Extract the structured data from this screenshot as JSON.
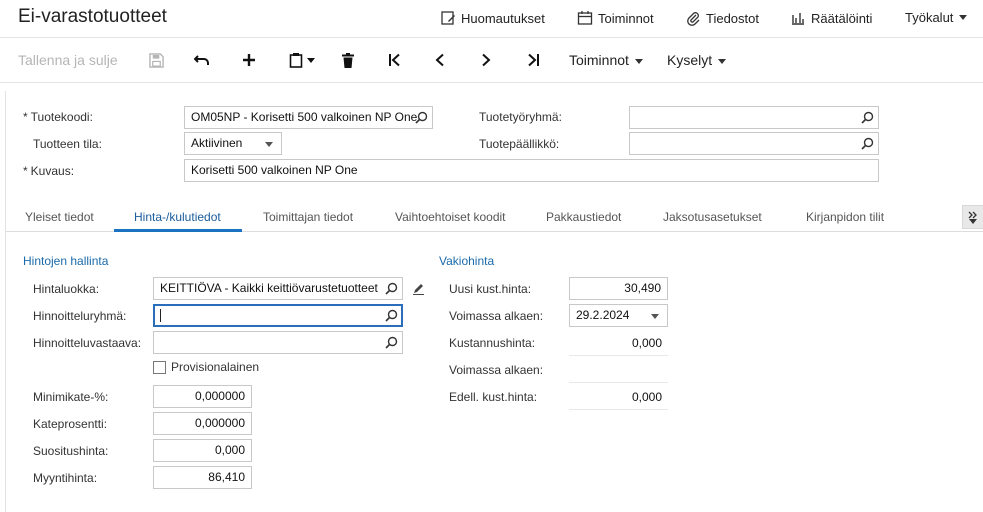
{
  "window": {
    "title": "Ei-varastotuotteet"
  },
  "top_menu": {
    "notes": "Huomautukset",
    "actions": "Toiminnot",
    "files": "Tiedostot",
    "customize": "Räätälöinti",
    "tools": "Työkalut"
  },
  "toolbar": {
    "save_close": "Tallenna ja sulje",
    "actions": "Toiminnot",
    "inquiries": "Kyselyt"
  },
  "header_form": {
    "item_code_label": "Tuotekoodi:",
    "item_code_value": "OM05NP - Korisetti 500 valkoinen NP One",
    "item_status_label": "Tuotteen tila:",
    "item_status_value": "Aktiivinen",
    "description_label": "Kuvaus:",
    "description_value": "Korisetti 500 valkoinen NP One",
    "item_class_label": "Tuotetyöryhmä:",
    "item_class_value": "",
    "product_manager_label": "Tuotepäällikkö:",
    "product_manager_value": ""
  },
  "tabs": [
    {
      "label": "Yleiset tiedot"
    },
    {
      "label": "Hinta-/kulutiedot"
    },
    {
      "label": "Toimittajan tiedot"
    },
    {
      "label": "Vaihtoehtoiset koodit"
    },
    {
      "label": "Pakkaustiedot"
    },
    {
      "label": "Jaksotusasetukset"
    },
    {
      "label": "Kirjanpidon tilit"
    }
  ],
  "active_tab": "Hinta-/kulutiedot",
  "price_management": {
    "title": "Hintojen hallinta",
    "price_class_label": "Hintaluokka:",
    "price_class_value": "KEITTIÖVA - Kaikki keittiövarustetuotteet",
    "pricing_group_label": "Hinnoitteluryhmä:",
    "pricing_group_value": "",
    "pricing_manager_label": "Hinnoitteluvastaava:",
    "pricing_manager_value": "",
    "commission_label": "Provisionalainen",
    "commission_checked": false,
    "min_markup_label": "Minimikate-%:",
    "min_markup_value": "0,000000",
    "markup_label": "Kateprosentti:",
    "markup_value": "0,000000",
    "msrp_label": "Suositushinta:",
    "msrp_value": "0,000",
    "sales_price_label": "Myyntihinta:",
    "sales_price_value": "86,410"
  },
  "standard_cost": {
    "title": "Vakiohinta",
    "new_cost_label": "Uusi kust.hinta:",
    "new_cost_value": "30,490",
    "effective_date_label": "Voimassa alkaen:",
    "effective_date_value": "29.2.2024",
    "cost_label": "Kustannushinta:",
    "cost_value": "0,000",
    "effective_date2_label": "Voimassa alkaen:",
    "effective_date2_value": "",
    "prev_cost_label": "Edell. kust.hinta:",
    "prev_cost_value": "0,000"
  },
  "colors": {
    "accent": "#1a73c0",
    "section_title": "#1a6aab",
    "disabled": "#b5b5b5"
  }
}
